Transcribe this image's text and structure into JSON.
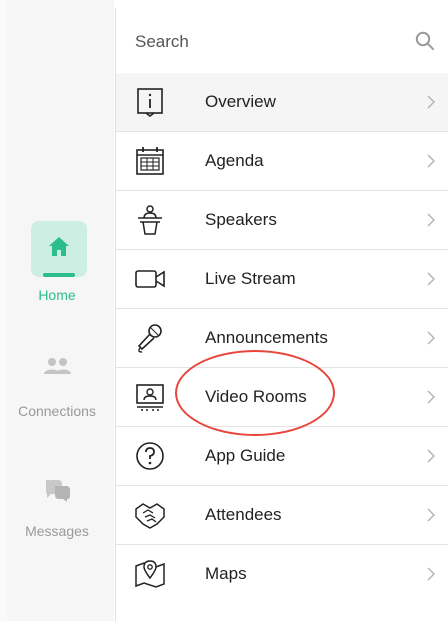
{
  "colors": {
    "accent": "#2bbd8b",
    "accent_bg": "#cdeee2",
    "muted": "#9a9a9a",
    "annotation": "#e8453c"
  },
  "bottom_nav": [
    {
      "label": "Home",
      "icon": "home-icon",
      "active": true
    },
    {
      "label": "Connections",
      "icon": "people-icon",
      "active": false
    },
    {
      "label": "Messages",
      "icon": "chat-bubbles-icon",
      "active": false
    }
  ],
  "search": {
    "placeholder": "Search",
    "icon": "search-icon"
  },
  "menu": [
    {
      "label": "Overview",
      "icon": "info-icon",
      "active": true
    },
    {
      "label": "Agenda",
      "icon": "calendar-icon"
    },
    {
      "label": "Speakers",
      "icon": "podium-icon"
    },
    {
      "label": "Live Stream",
      "icon": "video-camera-icon"
    },
    {
      "label": "Announcements",
      "icon": "microphone-icon"
    },
    {
      "label": "Video Rooms",
      "icon": "video-room-icon",
      "highlighted": true
    },
    {
      "label": "App Guide",
      "icon": "question-icon"
    },
    {
      "label": "Attendees",
      "icon": "handshake-icon"
    },
    {
      "label": "Maps",
      "icon": "map-pin-icon"
    }
  ]
}
